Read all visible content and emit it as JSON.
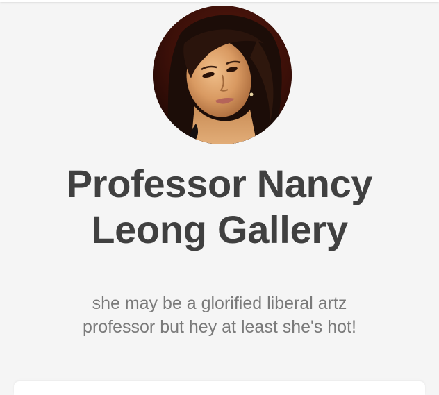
{
  "profile": {
    "title_line1": "Professor Nancy",
    "title_line2": "Leong Gallery",
    "description_line1": "she may be a glorified liberal artz",
    "description_line2": "professor but hey at least she's hot!"
  },
  "colors": {
    "background": "#f5f5f5",
    "title": "#404040",
    "description": "#7a7a7a",
    "card": "#ffffff"
  }
}
